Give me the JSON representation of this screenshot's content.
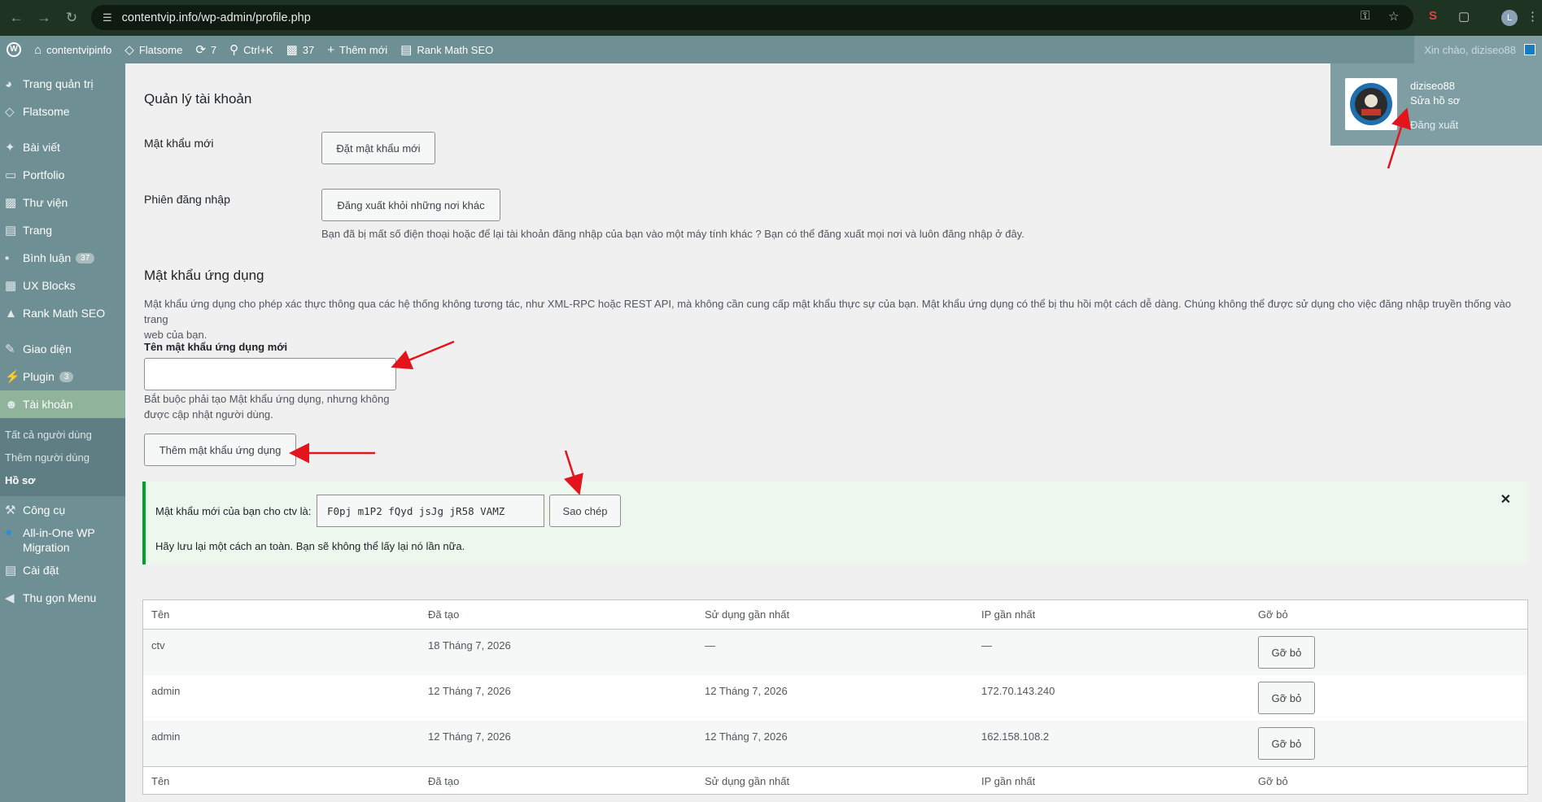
{
  "browser": {
    "url": "contentvip.info/wp-admin/profile.php",
    "profile_initial": "L"
  },
  "admin_bar": {
    "site_name": "contentvipinfo",
    "theme": "Flatsome",
    "updates": "7",
    "shortcut": "Ctrl+K",
    "comments": "37",
    "new": "Thêm mới",
    "seo": "Rank Math SEO",
    "greeting": "Xin chào, diziseo88"
  },
  "sidebar": {
    "items": [
      {
        "label": "Trang quản trị",
        "icon": "dashboard-icon"
      },
      {
        "label": "Flatsome",
        "icon": "diamond-icon"
      },
      {
        "label": "Bài viết",
        "icon": "pin-icon"
      },
      {
        "label": "Portfolio",
        "icon": "folder-icon"
      },
      {
        "label": "Thư viện",
        "icon": "media-icon"
      },
      {
        "label": "Trang",
        "icon": "page-icon"
      },
      {
        "label": "Bình luận",
        "icon": "comment-icon",
        "badge": "37"
      },
      {
        "label": "UX Blocks",
        "icon": "grid-icon"
      },
      {
        "label": "Rank Math SEO",
        "icon": "chart-icon"
      },
      {
        "label": "Giao diện",
        "icon": "brush-icon"
      },
      {
        "label": "Plugin",
        "icon": "plug-icon",
        "badge": "3"
      },
      {
        "label": "Tài khoản",
        "icon": "user-icon"
      },
      {
        "label": "Công cụ",
        "icon": "wrench-icon"
      },
      {
        "label": "All-in-One WP Migration",
        "icon": "migration-icon"
      },
      {
        "label": "Cài đặt",
        "icon": "settings-icon"
      },
      {
        "label": "Thu gọn Menu",
        "icon": "collapse-icon"
      }
    ],
    "submenu": [
      "Tất cả người dùng",
      "Thêm người dùng",
      "Hồ sơ"
    ]
  },
  "account": {
    "title": "Quản lý tài khoản",
    "new_password_label": "Mật khẩu mới",
    "set_password_btn": "Đặt mật khẩu mới",
    "sessions_label": "Phiên đăng nhập",
    "logout_elsewhere_btn": "Đăng xuất khỏi những nơi khác",
    "sessions_desc": "Bạn đã bị mất số điện thoại hoặc để lại tài khoản đăng nhập của bạn vào một máy tính khác ? Bạn có thể đăng xuất mọi nơi và luôn đăng nhập ở đây."
  },
  "app_passwords": {
    "title": "Mật khẩu ứng dụng",
    "desc_line1": "Mật khẩu ứng dụng cho phép xác thực thông qua các hệ thống không tương tác, như XML-RPC hoặc REST API, mà không cần cung cấp mật khẩu thực sự của bạn. Mật khẩu ứng dụng có thể bị thu hồi một cách dễ dàng. Chúng không thể được sử dụng cho việc đăng nhập truyền thống vào trang",
    "desc_line2": "web của bạn.",
    "new_name_label": "Tên mật khẩu ứng dụng mới",
    "new_name_value": "",
    "hint_line1": "Bắt buộc phải tạo Mật khẩu ứng dụng, nhưng không",
    "hint_line2": "được cập nhật người dùng.",
    "add_btn": "Thêm mật khẩu ứng dụng"
  },
  "notice": {
    "prefix": "Mật khẩu mới của bạn cho",
    "user": "ctv",
    "suffix": "là:",
    "password": "F0pj m1P2 fQyd jsJg jR58 VAMZ",
    "copy_btn": "Sao chép",
    "warning": "Hãy lưu lại một cách an toàn. Bạn sẽ không thể lấy lại nó lần nữa.",
    "close": "✕"
  },
  "table": {
    "headers": [
      "Tên",
      "Đã tạo",
      "Sử dụng gần nhất",
      "IP gần nhất",
      "Gỡ bỏ"
    ],
    "rows": [
      {
        "name": "ctv",
        "created": "18 Tháng 7, 2026",
        "last_used": "—",
        "last_ip": "—",
        "action": "Gỡ bỏ"
      },
      {
        "name": "admin",
        "created": "12 Tháng 7, 2026",
        "last_used": "12 Tháng 7, 2026",
        "last_ip": "172.70.143.240",
        "action": "Gỡ bỏ"
      },
      {
        "name": "admin",
        "created": "12 Tháng 7, 2026",
        "last_used": "12 Tháng 7, 2026",
        "last_ip": "162.158.108.2",
        "action": "Gỡ bỏ"
      }
    ]
  },
  "popover": {
    "username": "diziseo88",
    "edit_profile": "Sửa hồ sơ",
    "logout": "Đăng xuất"
  },
  "colors": {
    "admin_bar": "#6e8f94",
    "annotation_arrow": "#e3141b",
    "notice_border": "#00a32a"
  }
}
